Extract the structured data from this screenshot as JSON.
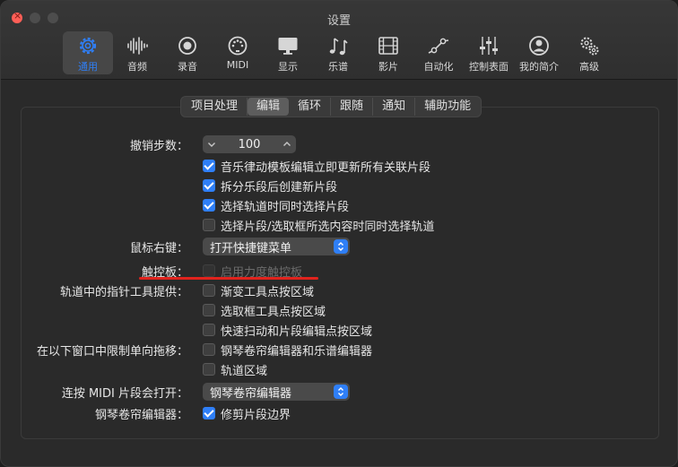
{
  "window": {
    "title": "设置"
  },
  "toolbar": {
    "items": [
      {
        "label": "通用",
        "icon": "gear-icon",
        "active": true
      },
      {
        "label": "音频",
        "icon": "waveform-icon"
      },
      {
        "label": "录音",
        "icon": "record-icon"
      },
      {
        "label": "MIDI",
        "icon": "midi-port-icon"
      },
      {
        "label": "显示",
        "icon": "monitor-icon"
      },
      {
        "label": "乐谱",
        "icon": "music-notes-icon"
      },
      {
        "label": "影片",
        "icon": "film-icon"
      },
      {
        "label": "自动化",
        "icon": "automation-curve-icon"
      },
      {
        "label": "控制表面",
        "icon": "faders-icon"
      },
      {
        "label": "我的简介",
        "icon": "profile-icon"
      },
      {
        "label": "高级",
        "icon": "gears-icon"
      }
    ]
  },
  "tabs": [
    "项目处理",
    "编辑",
    "循环",
    "跟随",
    "通知",
    "辅助功能"
  ],
  "selected_tab": "编辑",
  "settings": {
    "undo": {
      "label": "撤销步数：",
      "value": "100"
    },
    "undo_options": [
      {
        "text": "音乐律动模板编辑立即更新所有关联片段",
        "checked": true
      },
      {
        "text": "拆分乐段后创建新片段",
        "checked": true
      },
      {
        "text": "选择轨道时同时选择片段",
        "checked": true
      },
      {
        "text": "选择片段/选取框所选内容时同时选择轨道",
        "checked": false
      }
    ],
    "right_click": {
      "label": "鼠标右键：",
      "value": "打开快捷键菜单"
    },
    "trackpad": {
      "label": "触控板：",
      "option": "启用力度触控板",
      "checked": false,
      "disabled": true
    },
    "pointer_tool": {
      "label": "轨道中的指针工具提供：",
      "options": [
        {
          "text": "渐变工具点按区域",
          "checked": false
        },
        {
          "text": "选取框工具点按区域",
          "checked": false
        },
        {
          "text": "快速扫动和片段编辑点按区域",
          "checked": false
        }
      ]
    },
    "limit_drag": {
      "label": "在以下窗口中限制单向拖移：",
      "options": [
        {
          "text": "钢琴卷帘编辑器和乐谱编辑器",
          "checked": false
        },
        {
          "text": "轨道区域",
          "checked": false
        }
      ]
    },
    "midi_open": {
      "label": "连按 MIDI 片段会打开：",
      "value": "钢琴卷帘编辑器"
    },
    "piano_roll": {
      "label": "钢琴卷帘编辑器：",
      "option": "修剪片段边界",
      "checked": true
    }
  },
  "colors": {
    "accent": "#2f7ff7",
    "annotation": "#e0231d",
    "background": "#2a2a2a"
  }
}
